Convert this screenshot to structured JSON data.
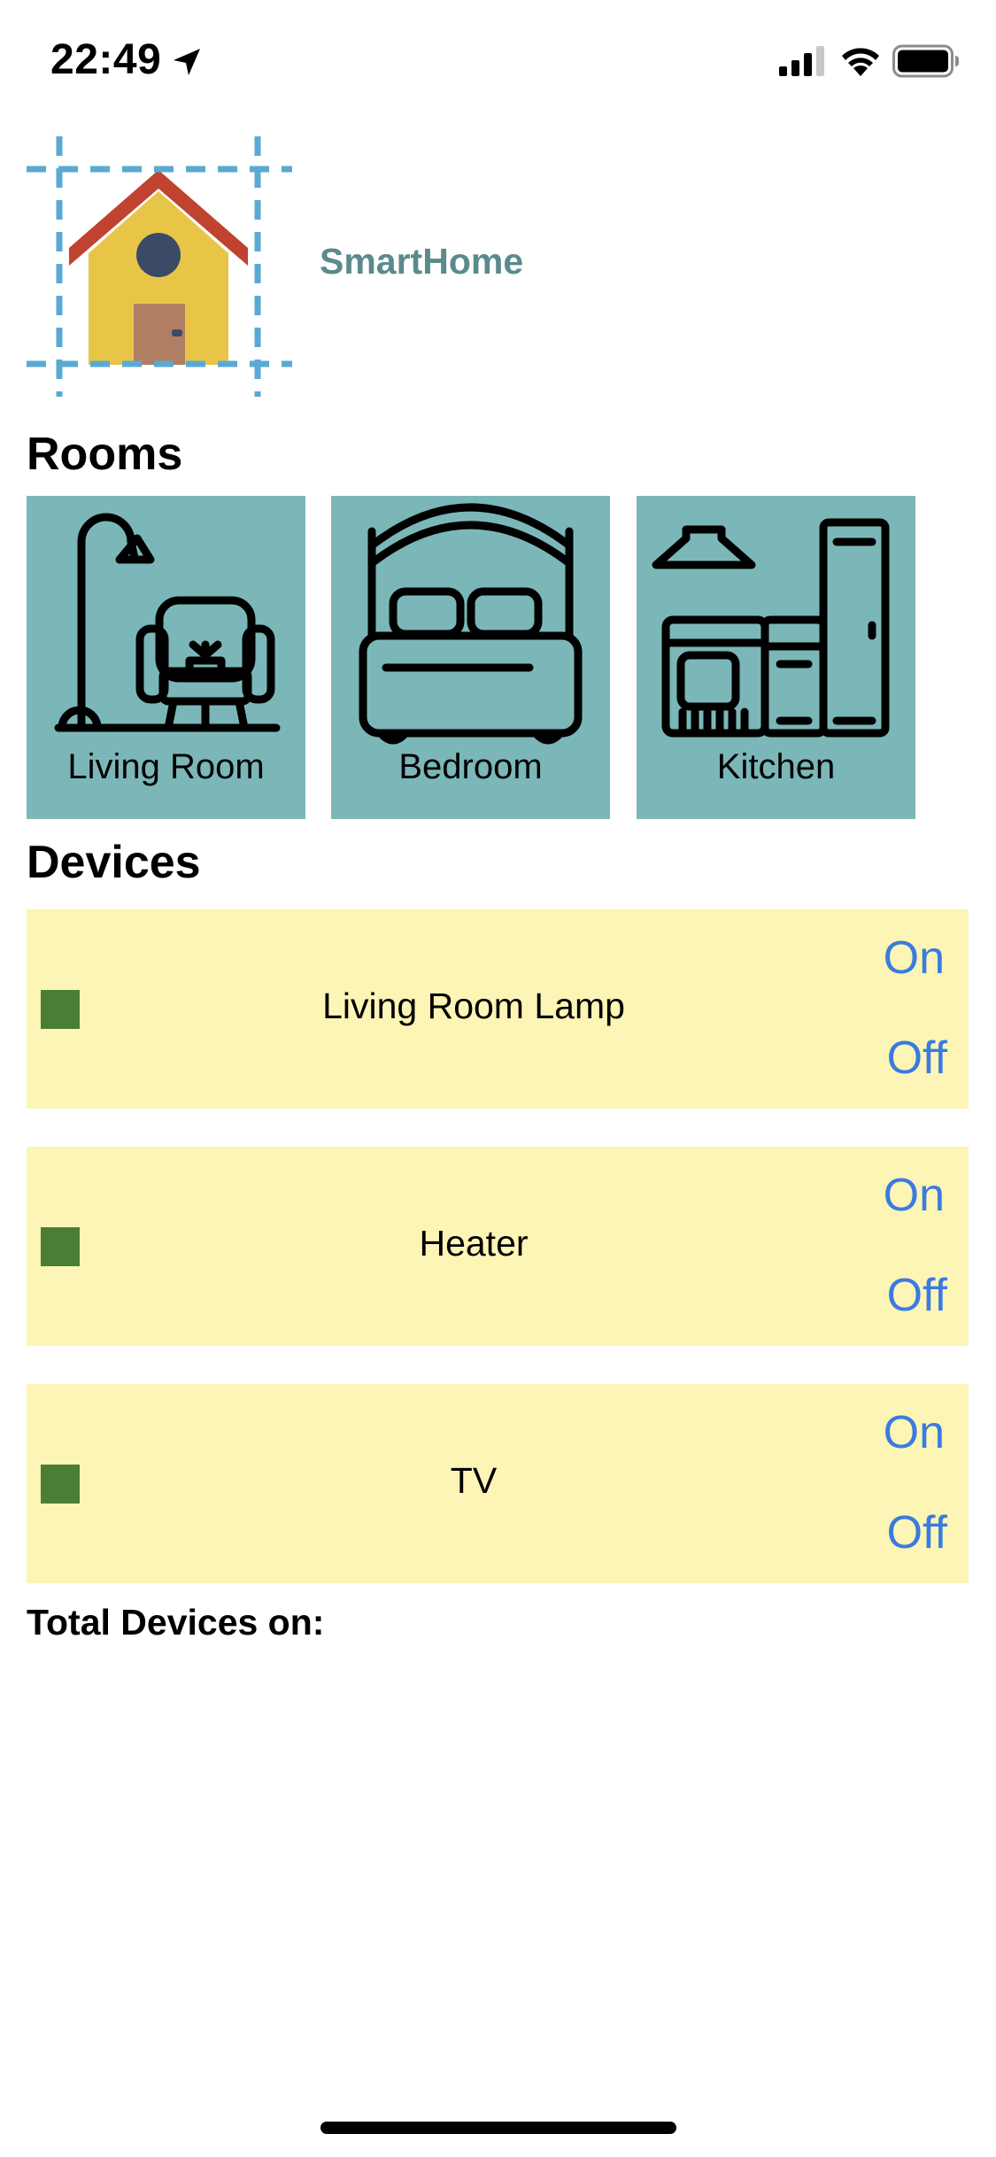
{
  "status_bar": {
    "time": "22:49",
    "icons": [
      "location-arrow-icon",
      "cellular-signal-icon",
      "wifi-icon",
      "battery-icon"
    ]
  },
  "header": {
    "logo_icon": "house-icon",
    "title": "SmartHome"
  },
  "rooms": {
    "title": "Rooms",
    "items": [
      {
        "label": "Living Room",
        "icon": "armchair-lamp-icon"
      },
      {
        "label": "Bedroom",
        "icon": "bed-icon"
      },
      {
        "label": "Kitchen",
        "icon": "kitchen-icon"
      }
    ]
  },
  "devices": {
    "title": "Devices",
    "items": [
      {
        "name": "Living Room Lamp",
        "on_label": "On",
        "off_label": "Off",
        "indicator_color": "#4b7e35"
      },
      {
        "name": "Heater",
        "on_label": "On",
        "off_label": "Off",
        "indicator_color": "#4b7e35"
      },
      {
        "name": "TV",
        "on_label": "On",
        "off_label": "Off",
        "indicator_color": "#4b7e35"
      }
    ]
  },
  "total": {
    "label": "Total Devices on:"
  },
  "colors": {
    "room_tile": "#7bb7b8",
    "device_row": "#fcf5b5",
    "button_text": "#3a7be0",
    "title_accent": "#5b8a8c"
  }
}
